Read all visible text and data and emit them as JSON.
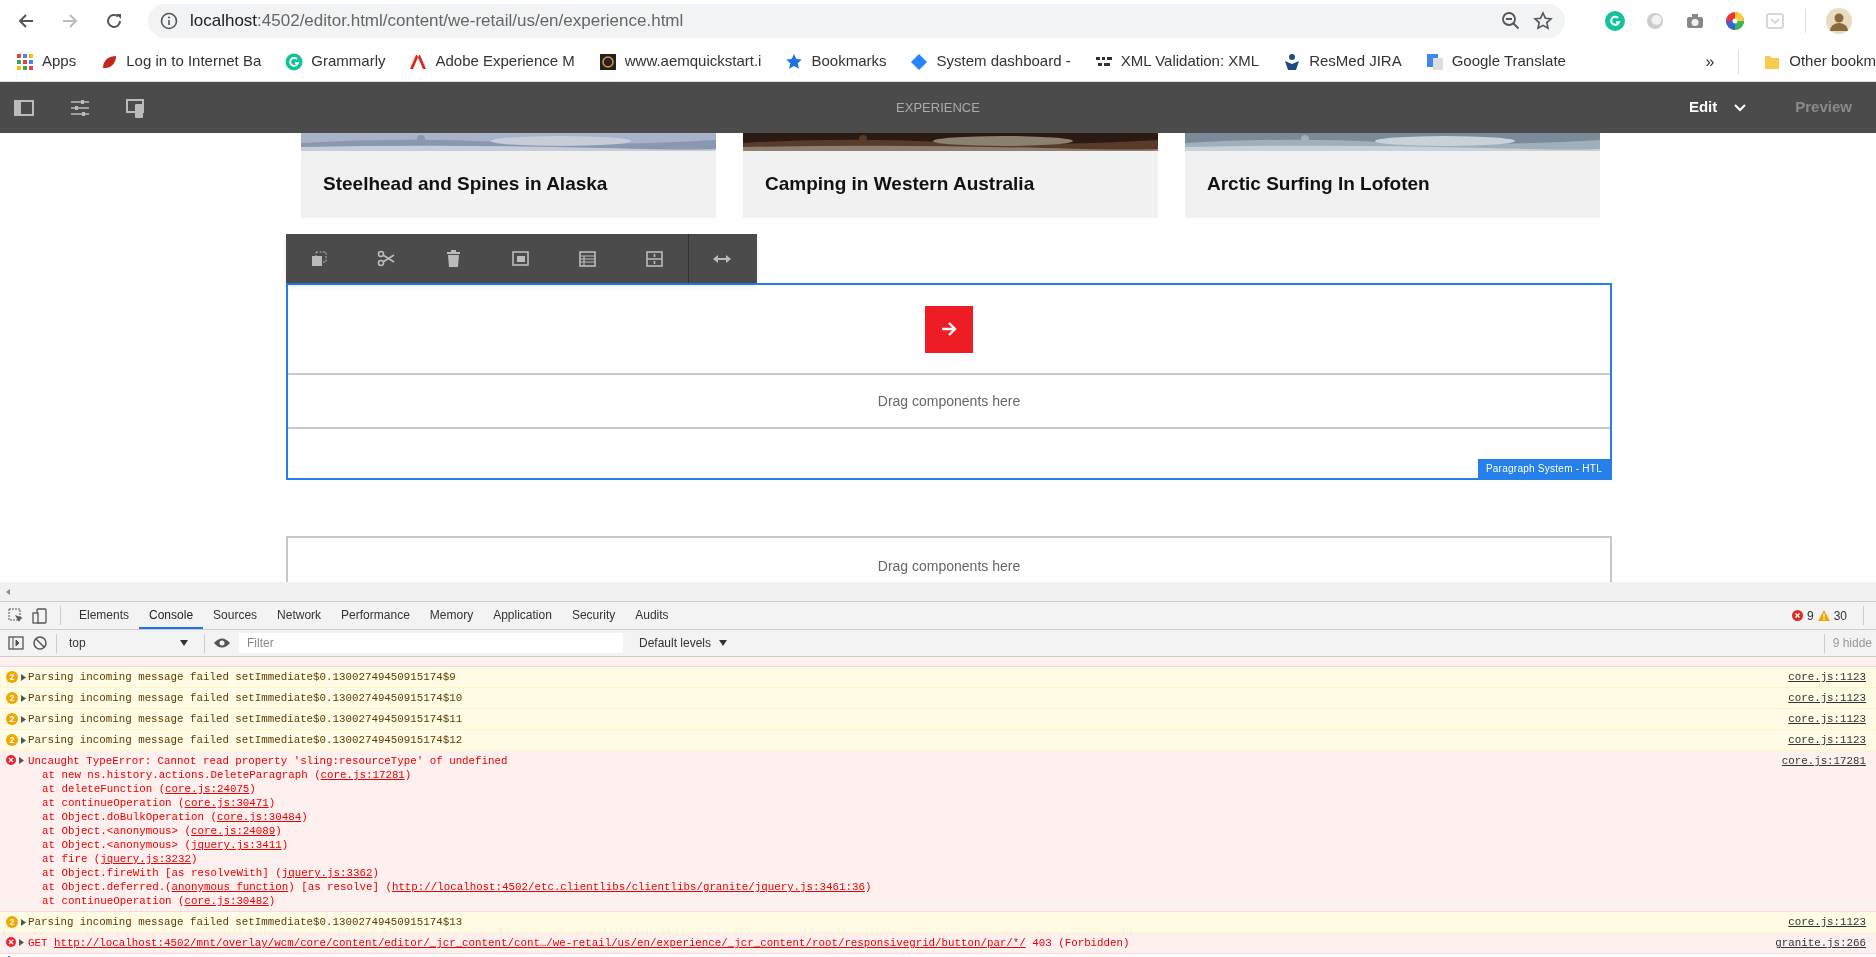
{
  "browser": {
    "url_host": "localhost",
    "url_rest": ":4502/editor.html/content/we-retail/us/en/experience.html",
    "bookmarks": [
      {
        "label": "Apps",
        "kind": "apps"
      },
      {
        "label": "Log in to Internet Ba",
        "kind": "leaf"
      },
      {
        "label": "Grammarly",
        "kind": "grammarly"
      },
      {
        "label": "Adobe Experience M",
        "kind": "adobe"
      },
      {
        "label": "www.aemquickstart.i",
        "kind": "square"
      },
      {
        "label": "Bookmarks",
        "kind": "star"
      },
      {
        "label": "System dashboard -",
        "kind": "diamond"
      },
      {
        "label": "XML Validation: XML",
        "kind": "xml"
      },
      {
        "label": "ResMed JIRA",
        "kind": "jira"
      },
      {
        "label": "Google Translate",
        "kind": "translate"
      }
    ],
    "overflow": "»",
    "other": "Other bookm"
  },
  "aem_toolbar": {
    "title": "EXPERIENCE",
    "mode": "Edit",
    "preview": "Preview"
  },
  "cards": [
    {
      "title": "Steelhead and Spines in Alaska",
      "kind": "picture"
    },
    {
      "title": "Camping in Western Australia",
      "kind": "picture"
    },
    {
      "title": "Arctic Surfing In Lofoten",
      "kind": "picture"
    }
  ],
  "paragraph": {
    "drop_text": "Drag components here",
    "label": "Paragraph System - HTL"
  },
  "second_drop_text": "Drag components here",
  "devtools": {
    "tabs": [
      {
        "label": "Elements",
        "selected": false
      },
      {
        "label": "Console",
        "selected": true
      },
      {
        "label": "Sources",
        "selected": false
      },
      {
        "label": "Network",
        "selected": false
      },
      {
        "label": "Performance",
        "selected": false
      },
      {
        "label": "Memory",
        "selected": false
      },
      {
        "label": "Application",
        "selected": false
      },
      {
        "label": "Security",
        "selected": false
      },
      {
        "label": "Audits",
        "selected": false
      }
    ],
    "errors": "9",
    "warnings": "30",
    "context": "top",
    "filter_placeholder": "Filter",
    "levels": "Default levels",
    "hidden": "9 hidde",
    "messages": [
      {
        "kind": "warning",
        "count": "2",
        "text": "Parsing incoming message failed setImmediate$0.13002749450915174$9",
        "source": "core.js:1123"
      },
      {
        "kind": "warning",
        "count": "2",
        "text": "Parsing incoming message failed setImmediate$0.13002749450915174$10",
        "source": "core.js:1123"
      },
      {
        "kind": "warning",
        "count": "2",
        "text": "Parsing incoming message failed setImmediate$0.13002749450915174$11",
        "source": "core.js:1123"
      },
      {
        "kind": "warning",
        "count": "2",
        "text": "Parsing incoming message failed setImmediate$0.13002749450915174$12",
        "source": "core.js:1123"
      },
      {
        "kind": "error",
        "text": "Uncaught TypeError: Cannot read property 'sling:resourceType' of undefined",
        "source": "core.js:17281",
        "stack": [
          [
            {
              "text": "at new ns.history.actions.DeleteParagraph ("
            },
            {
              "text": "core.js:17281",
              "link": true
            },
            {
              "text": ")"
            }
          ],
          [
            {
              "text": "at deleteFunction ("
            },
            {
              "text": "core.js:24075",
              "link": true
            },
            {
              "text": ")"
            }
          ],
          [
            {
              "text": "at continueOperation ("
            },
            {
              "text": "core.js:30471",
              "link": true
            },
            {
              "text": ")"
            }
          ],
          [
            {
              "text": "at Object.doBulkOperation ("
            },
            {
              "text": "core.js:30484",
              "link": true
            },
            {
              "text": ")"
            }
          ],
          [
            {
              "text": "at Object.<anonymous> ("
            },
            {
              "text": "core.js:24089",
              "link": true
            },
            {
              "text": ")"
            }
          ],
          [
            {
              "text": "at Object.<anonymous> ("
            },
            {
              "text": "jquery.js:3411",
              "link": true
            },
            {
              "text": ")"
            }
          ],
          [
            {
              "text": "at fire ("
            },
            {
              "text": "jquery.js:3232",
              "link": true
            },
            {
              "text": ")"
            }
          ],
          [
            {
              "text": "at Object.fireWith [as resolveWith] ("
            },
            {
              "text": "jquery.js:3362",
              "link": true
            },
            {
              "text": ")"
            }
          ],
          [
            {
              "text": "at Object.deferred.("
            },
            {
              "text": "anonymous function",
              "link": true
            },
            {
              "text": ") [as resolve] ("
            },
            {
              "text": "http://localhost:4502/etc.clientlibs/clientlibs/granite/jquery.js:3461:36",
              "link": true
            },
            {
              "text": ")"
            }
          ],
          [
            {
              "text": "at continueOperation ("
            },
            {
              "text": "core.js:30482",
              "link": true
            },
            {
              "text": ")"
            }
          ]
        ]
      },
      {
        "kind": "warning",
        "count": "2",
        "text": "Parsing incoming message failed setImmediate$0.13002749450915174$13",
        "source": "core.js:1123"
      },
      {
        "kind": "error",
        "method": "GET",
        "url": "http://localhost:4502/mnt/overlay/wcm/core/content/editor/_jcr_content/cont…/we-retail/us/en/experience/_jcr_content/root/responsivegrid/button/par/*/",
        "status_text": "403 (Forbidden)",
        "source": "granite.js:266"
      }
    ]
  }
}
